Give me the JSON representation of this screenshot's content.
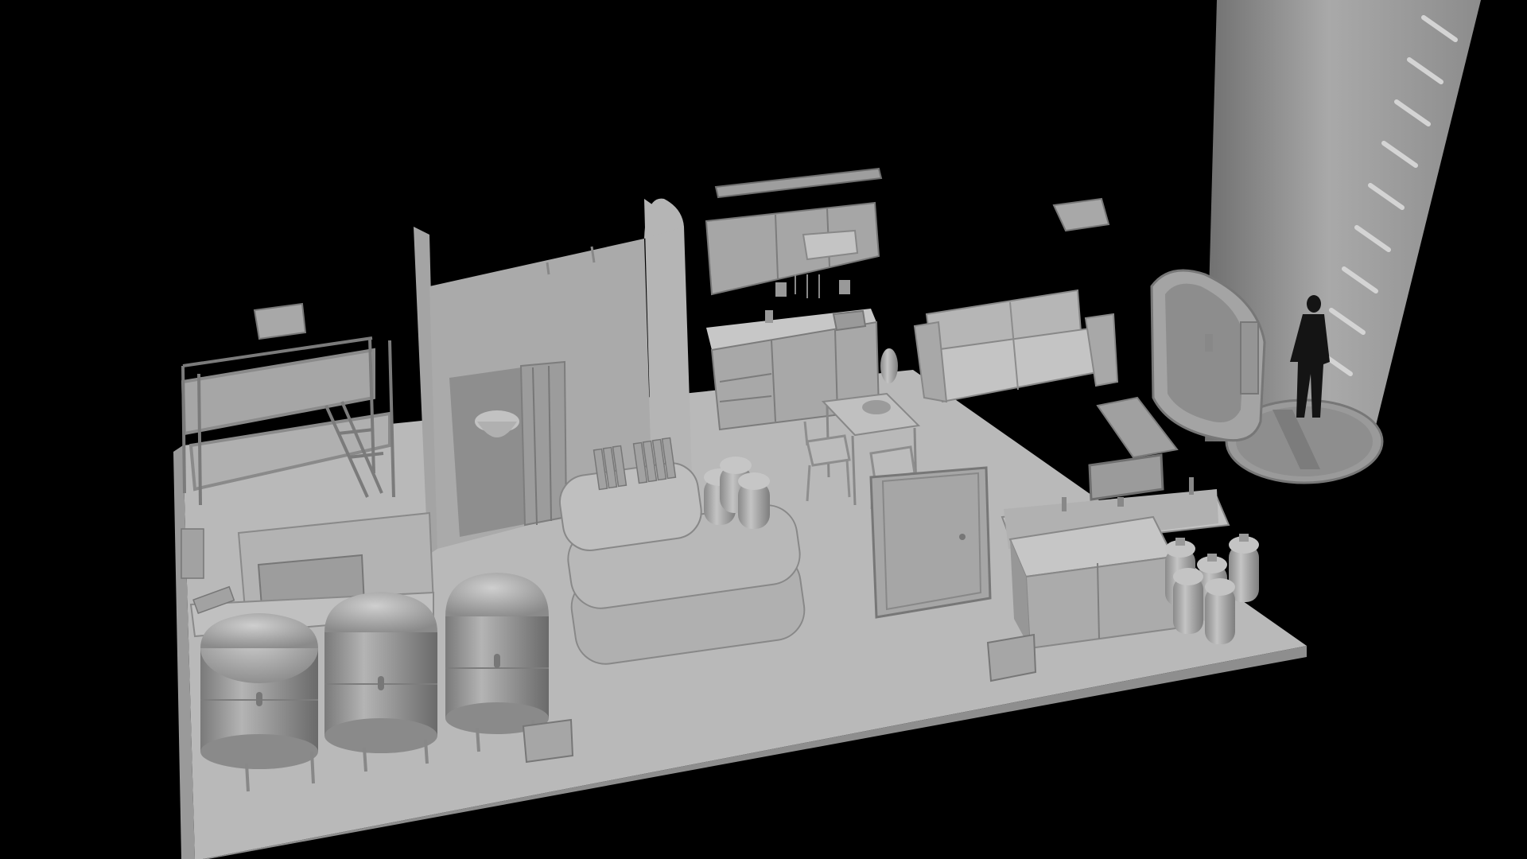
{
  "scene": {
    "background_color": "#000000",
    "render_style": "untextured grey clay render",
    "objects": [
      {
        "name": "floor-slab",
        "kind": "platform"
      },
      {
        "name": "bunk-bed",
        "kind": "furniture"
      },
      {
        "name": "shower-cubicle",
        "kind": "furniture"
      },
      {
        "name": "kitchen-wall-cabinets",
        "kind": "furniture"
      },
      {
        "name": "kitchen-counter",
        "kind": "furniture"
      },
      {
        "name": "sofa",
        "kind": "furniture"
      },
      {
        "name": "dining-table",
        "kind": "furniture"
      },
      {
        "name": "storage-tanks",
        "kind": "equipment",
        "count": 3
      },
      {
        "name": "sandbag-shelf",
        "kind": "furniture"
      },
      {
        "name": "water-jugs",
        "kind": "supplies"
      },
      {
        "name": "interior-door",
        "kind": "structure"
      },
      {
        "name": "desk-with-monitor",
        "kind": "furniture"
      },
      {
        "name": "entry-hatch",
        "kind": "structure"
      },
      {
        "name": "access-shaft",
        "kind": "structure"
      },
      {
        "name": "human-silhouette",
        "kind": "figure"
      }
    ]
  }
}
